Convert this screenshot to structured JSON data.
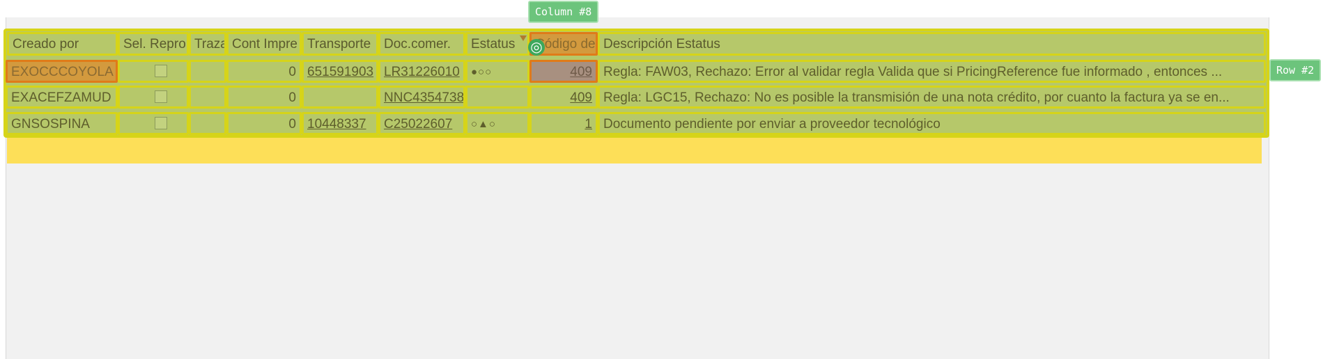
{
  "table": {
    "headers": [
      "Creado por",
      "Sel. Repro",
      "Traza",
      "Cont Impre",
      "Transporte",
      "Doc.comer.",
      "Estatus",
      "Código de",
      "Descripción Estatus"
    ],
    "rows": [
      {
        "creado_por": "EXOCCCOYOLA",
        "cont_impre": "0",
        "transporte": "651591903",
        "doc_comer": "LR31226010",
        "estatus": "●○○",
        "codigo": "409",
        "descripcion": "Regla: FAW03, Rechazo: Error al validar regla Valida que si PricingReference fue informado , entonces ..."
      },
      {
        "creado_por": "EXACEFZAMUD",
        "cont_impre": "0",
        "transporte": "",
        "doc_comer": "NNC4354738",
        "estatus": "",
        "codigo": "409",
        "descripcion": "Regla: LGC15, Rechazo: No es posible la transmisión de una nota crédito, por cuanto la factura ya se en..."
      },
      {
        "creado_por": "GNSOSPINA",
        "cont_impre": "0",
        "transporte": "10448337",
        "doc_comer": "C25022607",
        "estatus": "○▲○",
        "codigo": "1",
        "descripcion": "Documento pendiente por enviar a proveedor tecnológico"
      }
    ]
  },
  "overlay": {
    "column_tag": "Column #8",
    "row_tag": "Row #2",
    "target_icon": "target-icon"
  },
  "colors": {
    "grid_fill": "#b6c86a",
    "grid_border": "#d6d419",
    "selected_fill": "#d39a3e",
    "selected_border": "#e07b18",
    "empty_row_fill": "#fddf58",
    "tag_fill": "#6cc47c"
  }
}
